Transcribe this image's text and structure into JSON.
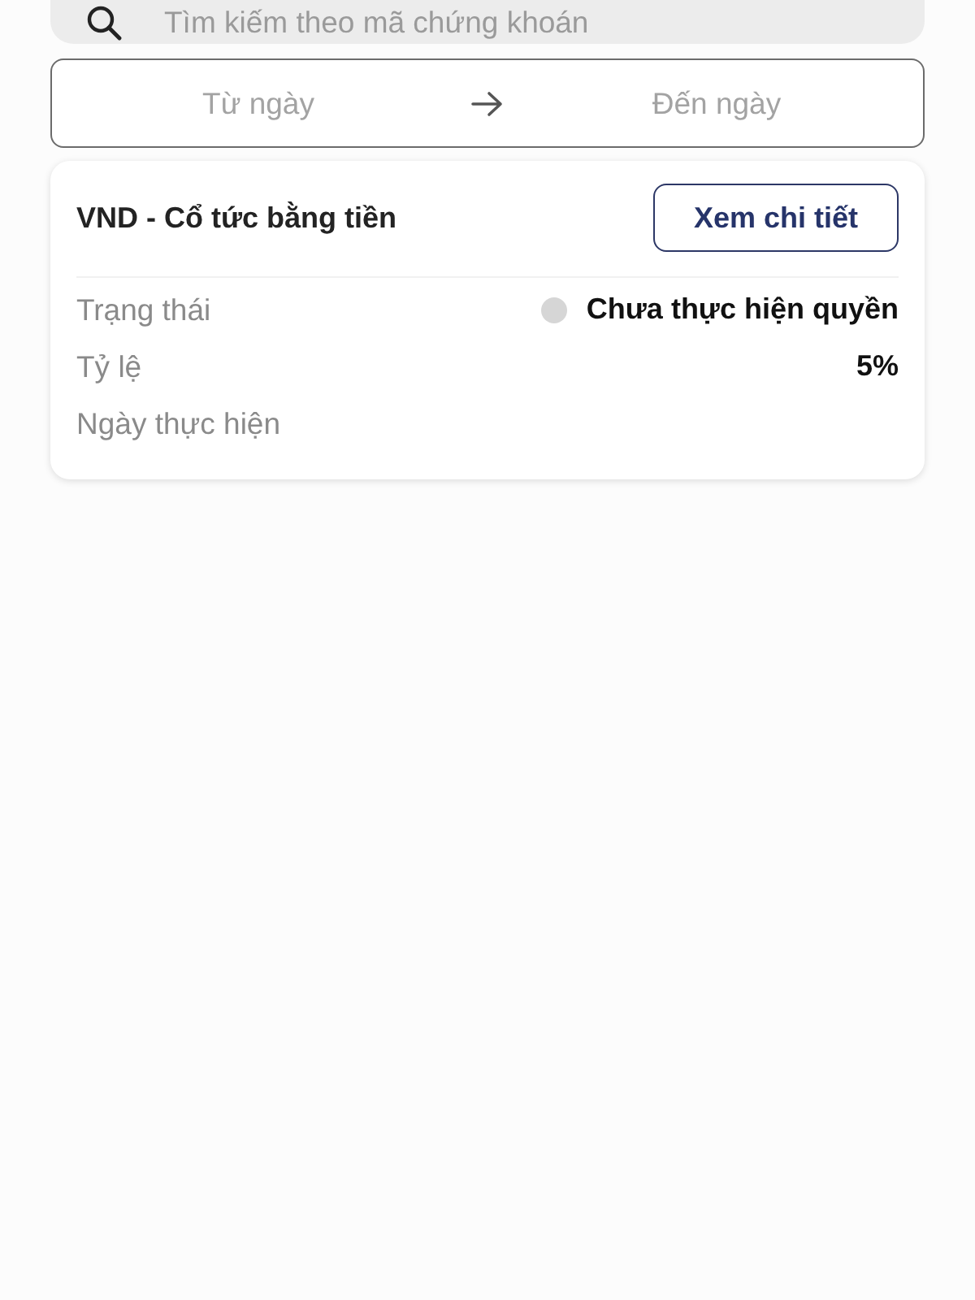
{
  "search": {
    "placeholder": "Tìm kiếm theo mã chứng khoán"
  },
  "date_range": {
    "from_placeholder": "Từ ngày",
    "to_placeholder": "Đến ngày"
  },
  "events": [
    {
      "title": "VND - Cổ tức bằng tiền",
      "button": "Xem chi tiết",
      "fields": [
        {
          "kind": "status",
          "label": "Trạng thái",
          "value": "Chưa thực hiện quyền",
          "color": "#d6d6d6"
        },
        {
          "kind": "text",
          "label": "Tỷ lệ",
          "value": "5%"
        },
        {
          "kind": "text",
          "label": "Ngày thực hiện"
        }
      ]
    }
  ]
}
